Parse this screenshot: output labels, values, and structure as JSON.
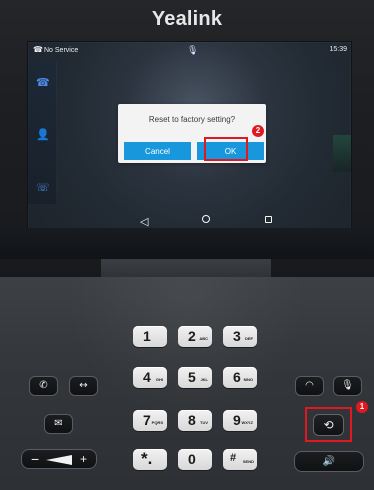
{
  "brand": {
    "name": "Yealink"
  },
  "screen": {
    "status": {
      "service": "No Service",
      "time": "15:39"
    },
    "dialog": {
      "message": "Reset to factory setting?",
      "cancel_label": "Cancel",
      "ok_label": "OK"
    },
    "annotations": {
      "ok_badge": "2"
    },
    "icons": {
      "status_phone": "phone-icon",
      "status_mic": "microphone-icon",
      "rail_1": "phone-icon",
      "rail_2": "contacts-icon",
      "rail_3": "call-log-icon",
      "nav_back": "back-icon",
      "nav_home": "home-icon",
      "nav_recent": "recent-apps-icon"
    }
  },
  "keypad": {
    "keys": [
      {
        "main": "1",
        "sub": ""
      },
      {
        "main": "2",
        "sub": "ABC"
      },
      {
        "main": "3",
        "sub": "DEF"
      },
      {
        "main": "4",
        "sub": "GHI"
      },
      {
        "main": "5",
        "sub": "JKL"
      },
      {
        "main": "6",
        "sub": "MNO"
      },
      {
        "main": "7",
        "sub": "PQRS"
      },
      {
        "main": "8",
        "sub": "TUV"
      },
      {
        "main": "9",
        "sub": "WXYZ"
      },
      {
        "main": "*.",
        "sub": ""
      },
      {
        "main": "0",
        "sub": ""
      },
      {
        "main": "#",
        "sub": "SEND"
      }
    ],
    "annotations": {
      "redial_badge": "1"
    },
    "icons": {
      "left_key_1": "handset-icon",
      "left_key_2": "transfer-icon",
      "left_key_3": "message-icon",
      "right_key_1": "headset-icon",
      "right_key_2": "mute-icon",
      "redial": "redial-icon",
      "speaker": "speaker-icon",
      "volume": "volume-icon"
    }
  },
  "colors": {
    "screen_accent": "#1997dc",
    "annotation": "#e0181f"
  }
}
